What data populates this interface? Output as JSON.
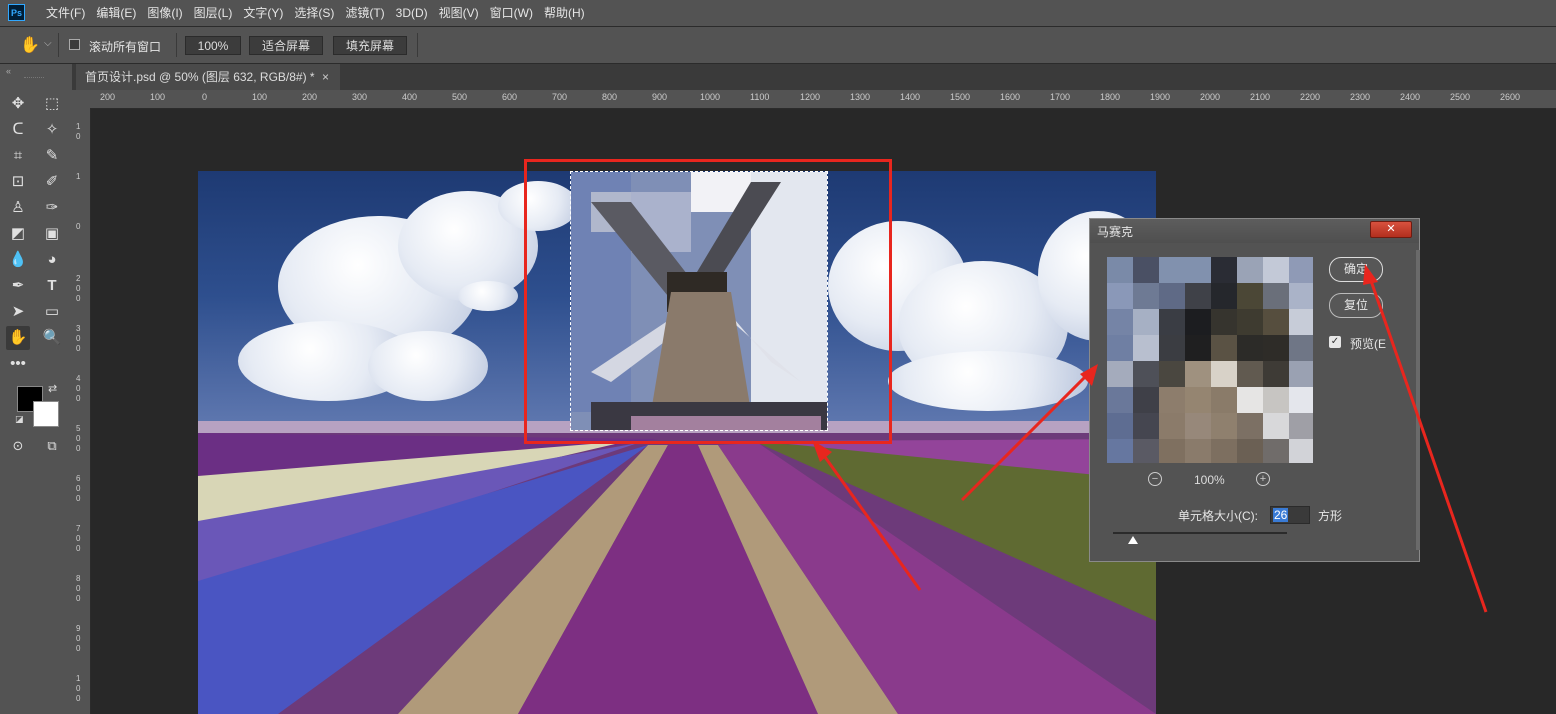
{
  "app": {
    "logo": "Ps"
  },
  "menu": [
    "文件(F)",
    "编辑(E)",
    "图像(I)",
    "图层(L)",
    "文字(Y)",
    "选择(S)",
    "滤镜(T)",
    "3D(D)",
    "视图(V)",
    "窗口(W)",
    "帮助(H)"
  ],
  "options_bar": {
    "scroll_all_label": "滚动所有窗口",
    "zoom_value": "100%",
    "fit_screen": "适合屏幕",
    "fill_screen": "填充屏幕"
  },
  "document_tab": {
    "title": "首页设计.psd @ 50% (图层 632, RGB/8#) *",
    "close": "×"
  },
  "ruler_h_ticks": [
    "200",
    "100",
    "0",
    "100",
    "200",
    "300",
    "400",
    "500",
    "600",
    "700",
    "800",
    "900",
    "1000",
    "1100",
    "1200",
    "1300",
    "1400",
    "1500",
    "1600",
    "1700",
    "1800",
    "1900",
    "2000",
    "2100",
    "2200",
    "2300",
    "2400",
    "2500",
    "2600"
  ],
  "ruler_v_ticks": [
    "1",
    "0",
    "1",
    "0",
    "2",
    "0",
    "0",
    "3",
    "0",
    "0",
    "4",
    "0",
    "0",
    "5",
    "0",
    "0",
    "6",
    "0",
    "0",
    "7",
    "0",
    "0",
    "8",
    "0",
    "0",
    "9",
    "0",
    "0",
    "1",
    "0",
    "0"
  ],
  "mosaic_dialog": {
    "title": "马赛克",
    "close": "✕",
    "ok_button": "确定",
    "reset_button": "复位",
    "preview_label": "预览(E",
    "zoom_out": "−",
    "zoom_level": "100%",
    "zoom_in": "+",
    "cell_size_label": "单元格大小(C):",
    "cell_size_value": "26",
    "unit": "方形"
  },
  "colors": {
    "annotation_red": "#e8261e",
    "ps_panel": "#535353",
    "ps_dark": "#282828",
    "selection_highlight": "#3a7bd5"
  },
  "icons": [
    "move-icon",
    "marquee-icon",
    "lasso-icon",
    "magic-wand-icon",
    "crop-icon",
    "eyedropper-icon",
    "frame-icon",
    "brush-icon",
    "stamp-icon",
    "history-brush-icon",
    "eraser-icon",
    "gradient-icon",
    "blur-icon",
    "dodge-icon",
    "pen-icon",
    "type-icon",
    "path-select-icon",
    "rectangle-icon",
    "hand-icon",
    "zoom-icon",
    "more-icon",
    "swap-colors-icon"
  ]
}
